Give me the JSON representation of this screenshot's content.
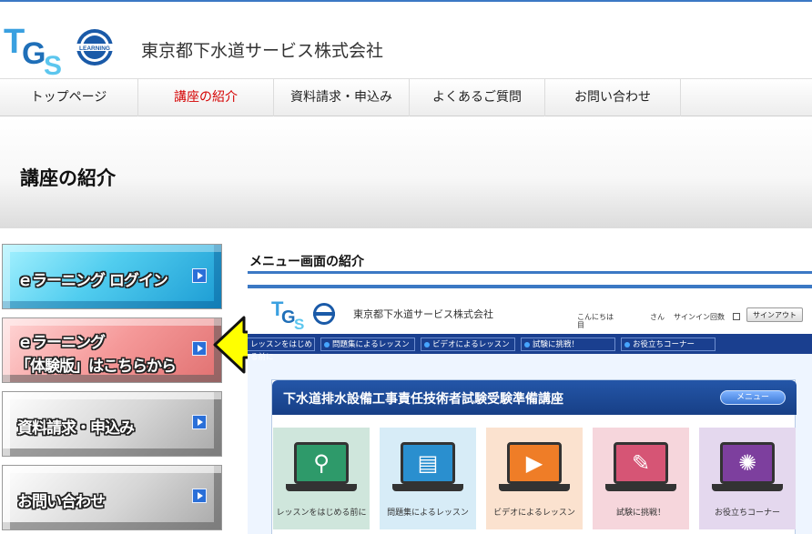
{
  "colors": {
    "accent": "#3b78c4",
    "nav_active": "#d40000",
    "preview_nav": "#1a3f8f"
  },
  "header": {
    "logo_text": "TGS",
    "logo_badge": "LEARNING",
    "company": "東京都下水道サービス株式会社"
  },
  "nav": {
    "items": [
      {
        "label": "トップページ",
        "active": false
      },
      {
        "label": "講座の紹介",
        "active": true
      },
      {
        "label": "資料請求・申込み",
        "active": false
      },
      {
        "label": "よくあるご質問",
        "active": false
      },
      {
        "label": "お問い合わせ",
        "active": false
      }
    ]
  },
  "page": {
    "title": "講座の紹介"
  },
  "sidebar": {
    "login": "ｅラーニング ログイン",
    "trial_line1": "ｅラーニング",
    "trial_line2": "「体験版」はこちらから",
    "request": "資料請求・申込み",
    "contact": "お問い合わせ"
  },
  "main": {
    "section_title": "メニュー画面の紹介",
    "preview": {
      "company": "東京都下水道サービス株式会社",
      "greeting": "こんにちは 目",
      "user_suffix": "さん",
      "signin_count": "サインイン回数",
      "signin_count_icon": "calendar-icon",
      "signout": "サインアウト",
      "nav": [
        "レッスンをはじめる前に",
        "問題集によるレッスン",
        "ビデオによるレッスン",
        "試験に挑戦！",
        "お役立ちコーナー"
      ],
      "panel_title": "下水道排水設備工事責任技術者試験受験準備講座",
      "menu_button": "メニュー",
      "cards": [
        {
          "caption": "レッスンをはじめる前に",
          "icon": "magnifier-icon",
          "bg": "#cfe6dc",
          "screen": "#2e9a6a"
        },
        {
          "caption": "問題集によるレッスン",
          "icon": "book-icon",
          "bg": "#d7ecf7",
          "screen": "#2a8fcf"
        },
        {
          "caption": "ビデオによるレッスン",
          "icon": "play-icon",
          "bg": "#fbe2cf",
          "screen": "#ef7d27"
        },
        {
          "caption": "試験に挑戦！",
          "icon": "pencil-icon",
          "bg": "#f6d6dc",
          "screen": "#d65575"
        },
        {
          "caption": "お役立ちコーナー",
          "icon": "lightbulb-icon",
          "bg": "#e4d8ee",
          "screen": "#7d3f9e"
        }
      ]
    }
  }
}
